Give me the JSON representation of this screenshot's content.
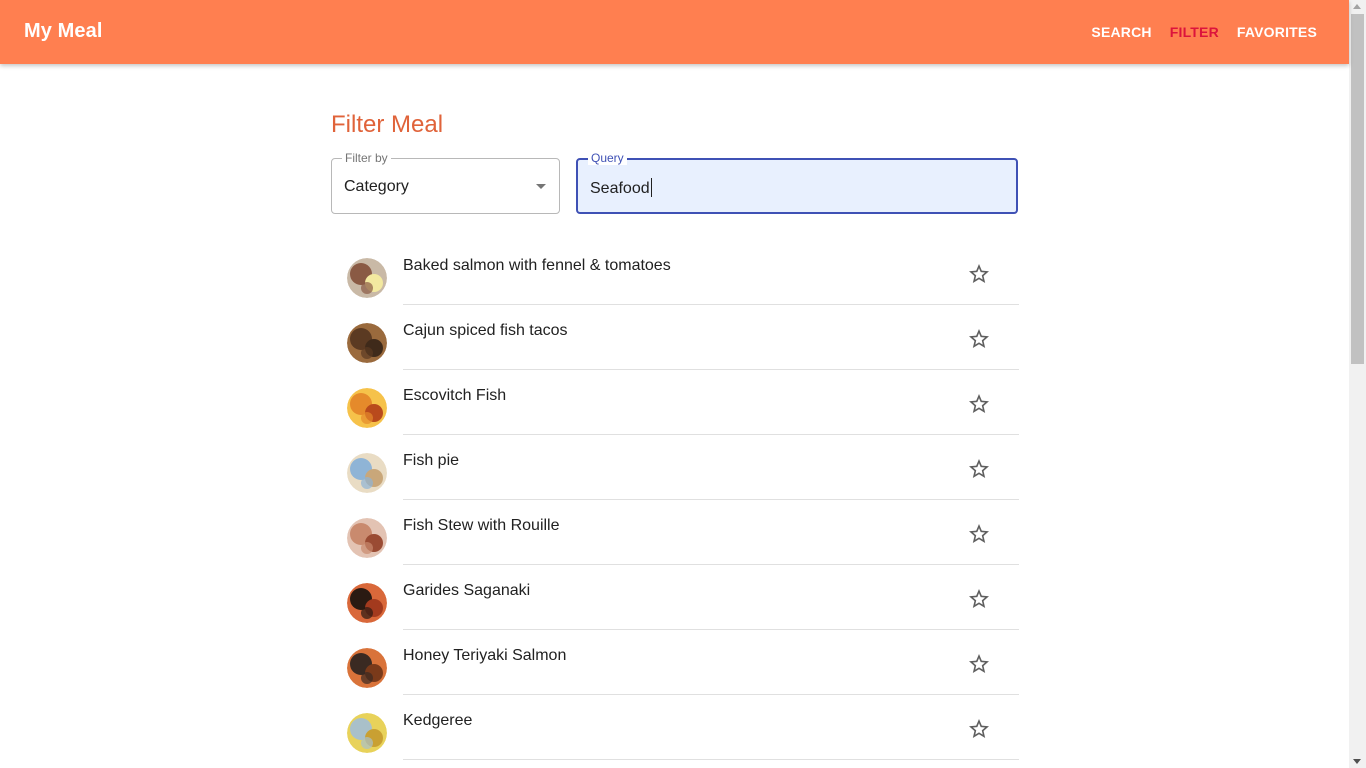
{
  "app": {
    "title": "My Meal"
  },
  "nav": {
    "search": "SEARCH",
    "filter": "FILTER",
    "favorites": "FAVORITES"
  },
  "page": {
    "title": "Filter Meal"
  },
  "filter": {
    "label": "Filter by",
    "value": "Category"
  },
  "query": {
    "label": "Query",
    "value": "Seafood"
  },
  "meals": [
    {
      "name": "Baked salmon with fennel & tomatoes",
      "favorite_icon": "star-outline-icon"
    },
    {
      "name": "Cajun spiced fish tacos",
      "favorite_icon": "star-outline-icon"
    },
    {
      "name": "Escovitch Fish",
      "favorite_icon": "star-outline-icon"
    },
    {
      "name": "Fish pie",
      "favorite_icon": "star-outline-icon"
    },
    {
      "name": "Fish Stew with Rouille",
      "favorite_icon": "star-outline-icon"
    },
    {
      "name": "Garides Saganaki",
      "favorite_icon": "star-outline-icon"
    },
    {
      "name": "Honey Teriyaki Salmon",
      "favorite_icon": "star-outline-icon"
    },
    {
      "name": "Kedgeree",
      "favorite_icon": "star-outline-icon"
    }
  ],
  "colors": {
    "appbar": "#ff7f50",
    "active_nav": "#dc143c",
    "title": "#e0633a",
    "focus": "#3f51b5"
  }
}
